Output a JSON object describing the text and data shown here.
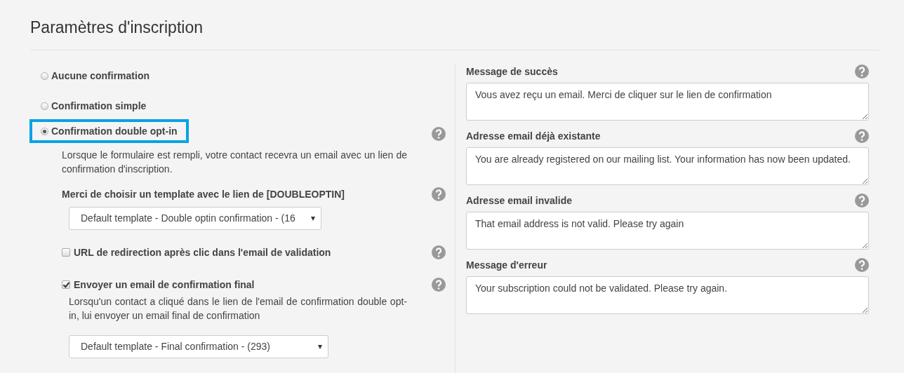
{
  "title": "Paramètres d'inscription",
  "confirmation_options": [
    {
      "label": "Aucune confirmation",
      "selected": false,
      "highlighted": false
    },
    {
      "label": "Confirmation simple",
      "selected": false,
      "highlighted": false
    },
    {
      "label": "Confirmation double opt-in",
      "selected": true,
      "highlighted": true
    }
  ],
  "double_optin": {
    "description": "Lorsque le formulaire est rempli, votre contact recevra un email avec un lien de confirmation d'inscription.",
    "template_label": "Merci de choisir un template avec le lien de [DOUBLEOPTIN]",
    "template_select": "Default template - Double optin confirmation - (16",
    "redirect": {
      "label": "URL de redirection après clic dans l'email de validation",
      "checked": false
    },
    "final_email": {
      "label": "Envoyer un email de confirmation final",
      "checked": true,
      "description": "Lorsqu'un contact a cliqué dans le lien de l'email de confirmation double opt-in, lui envoyer un email final de confirmation",
      "template_select": "Default template - Final confirmation - (293)"
    }
  },
  "messages": [
    {
      "label": "Message de succès",
      "value": "Vous avez reçu un email. Merci de cliquer sur le lien de confirmation"
    },
    {
      "label": "Adresse email déjà existante",
      "value": "You are already registered on our mailing list. Your information has now been updated."
    },
    {
      "label": "Adresse email invalide",
      "value": "That email address is not valid. Please try again"
    },
    {
      "label": "Message d'erreur",
      "value": "Your subscription could not be validated. Please try again."
    }
  ]
}
